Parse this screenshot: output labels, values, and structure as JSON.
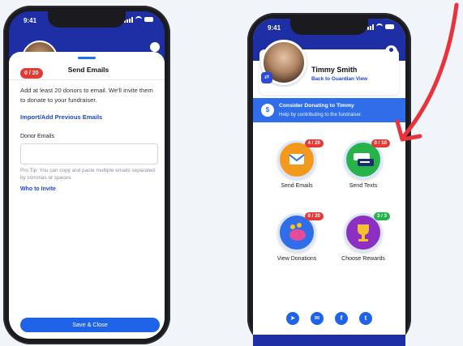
{
  "left_phone": {
    "status_time": "9:41",
    "progress_badge": "0 / 20",
    "title": "Send Emails",
    "intro_text": "Add at least 20 donors to email. We'll invite them to donate to your fundraiser.",
    "import_link": "Import/Add Previous Emails",
    "field_label": "Donor Emails",
    "field_value": "",
    "tip_text": "Pro Tip: You can copy and paste multiple emails separated by commas or spaces.",
    "who_link": "Who to Invite",
    "save_button": "Save & Close"
  },
  "right_phone": {
    "status_time": "9:41",
    "profile_name": "Timmy Smith",
    "back_link": "Back to Guardian View",
    "consider_title": "Consider Donating to Timmy",
    "consider_sub": "Help by contributing to the fundraiser.",
    "coin_symbol": "$",
    "tiles": [
      {
        "label": "Send Emails",
        "badge": "4 / 20",
        "badge_color": "#e53935",
        "circle_color": "#f39a1c"
      },
      {
        "label": "Send Texts",
        "badge": "0 / 10",
        "badge_color": "#e53935",
        "circle_color": "#27b24a"
      },
      {
        "label": "View Donations",
        "badge": "0 / 20",
        "badge_color": "#e53935",
        "circle_color": "#2f6ee8"
      },
      {
        "label": "Choose Rewards",
        "badge": "3 / 3",
        "badge_color": "#24b24a",
        "circle_color": "#8e2fc4"
      }
    ],
    "social": [
      "messenger-icon",
      "messenger-chat-icon",
      "facebook-icon",
      "twitter-icon"
    ]
  },
  "accent_arrow_color": "#e8323c"
}
